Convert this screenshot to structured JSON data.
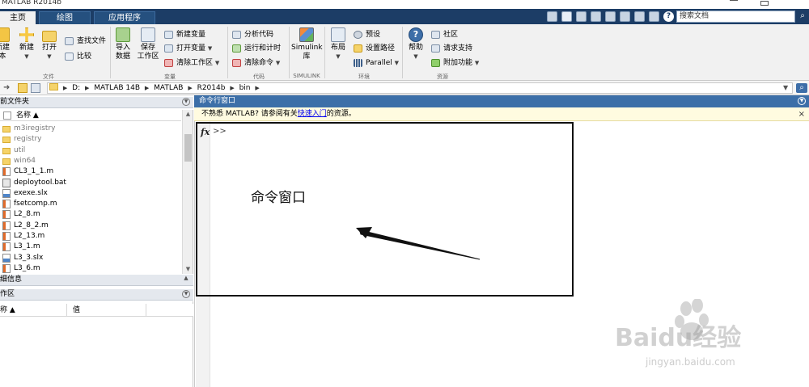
{
  "window": {
    "title": "MATLAB R2014b"
  },
  "tabs": [
    {
      "label": "主页",
      "active": true
    },
    {
      "label": "绘图",
      "active": false
    },
    {
      "label": "应用程序",
      "active": false
    }
  ],
  "search": {
    "placeholder": "搜索文档"
  },
  "ribbon": {
    "file": {
      "group_label": "文件",
      "new_script": "新建\n本",
      "new": "新建",
      "open": "打开",
      "find_files": "查找文件",
      "compare": "比较"
    },
    "variable": {
      "group_label": "变量",
      "import": "导入\n数据",
      "save_ws": "保存\n工作区",
      "new_var": "新建变量",
      "open_var": "打开变量",
      "clear_ws": "清除工作区"
    },
    "code": {
      "group_label": "代码",
      "analyze": "分析代码",
      "run_time": "运行和计时",
      "clear_cmd": "清除命令"
    },
    "simulink": {
      "group_label": "SIMULINK",
      "library": "Simulink\n库"
    },
    "environment": {
      "group_label": "环境",
      "layout": "布局",
      "prefs": "预设",
      "set_path": "设置路径",
      "parallel": "Parallel"
    },
    "resources": {
      "group_label": "资源",
      "help": "帮助",
      "community": "社区",
      "support": "请求支持",
      "addons": "附加功能"
    }
  },
  "address": {
    "segments": [
      "D:",
      "MATLAB 14B",
      "MATLAB",
      "R2014b",
      "bin"
    ]
  },
  "current_folder": {
    "title": "前文件夹",
    "column_name": "名称 ▲",
    "items": [
      {
        "name": "m3iregistry",
        "type": "folder"
      },
      {
        "name": "registry",
        "type": "folder"
      },
      {
        "name": "util",
        "type": "folder"
      },
      {
        "name": "win64",
        "type": "folder"
      },
      {
        "name": "CL3_1_1.m",
        "type": "m"
      },
      {
        "name": "deploytool.bat",
        "type": "bat"
      },
      {
        "name": "exexe.slx",
        "type": "slx"
      },
      {
        "name": "fsetcomp.m",
        "type": "m"
      },
      {
        "name": "L2_8.m",
        "type": "m"
      },
      {
        "name": "L2_8_2.m",
        "type": "m"
      },
      {
        "name": "L2_13.m",
        "type": "m"
      },
      {
        "name": "L3_1.m",
        "type": "m"
      },
      {
        "name": "L3_3.slx",
        "type": "slx"
      },
      {
        "name": "L3_6.m",
        "type": "m"
      }
    ]
  },
  "details": {
    "title": "细信息"
  },
  "workspace": {
    "title": "作区",
    "col_name": "称 ▲",
    "col_value": "值"
  },
  "command_window": {
    "title": "命令行窗口",
    "notice_prefix": "不熟悉 MATLAB? 请参阅有关",
    "notice_link": "快速入门",
    "notice_suffix": "的资源。",
    "close": "×",
    "fx": "fx",
    "prompt": ">>"
  },
  "annotation": {
    "label": "命令窗口"
  },
  "watermark": {
    "brand": "Baidu经验",
    "url": "jingyan.baidu.com"
  }
}
